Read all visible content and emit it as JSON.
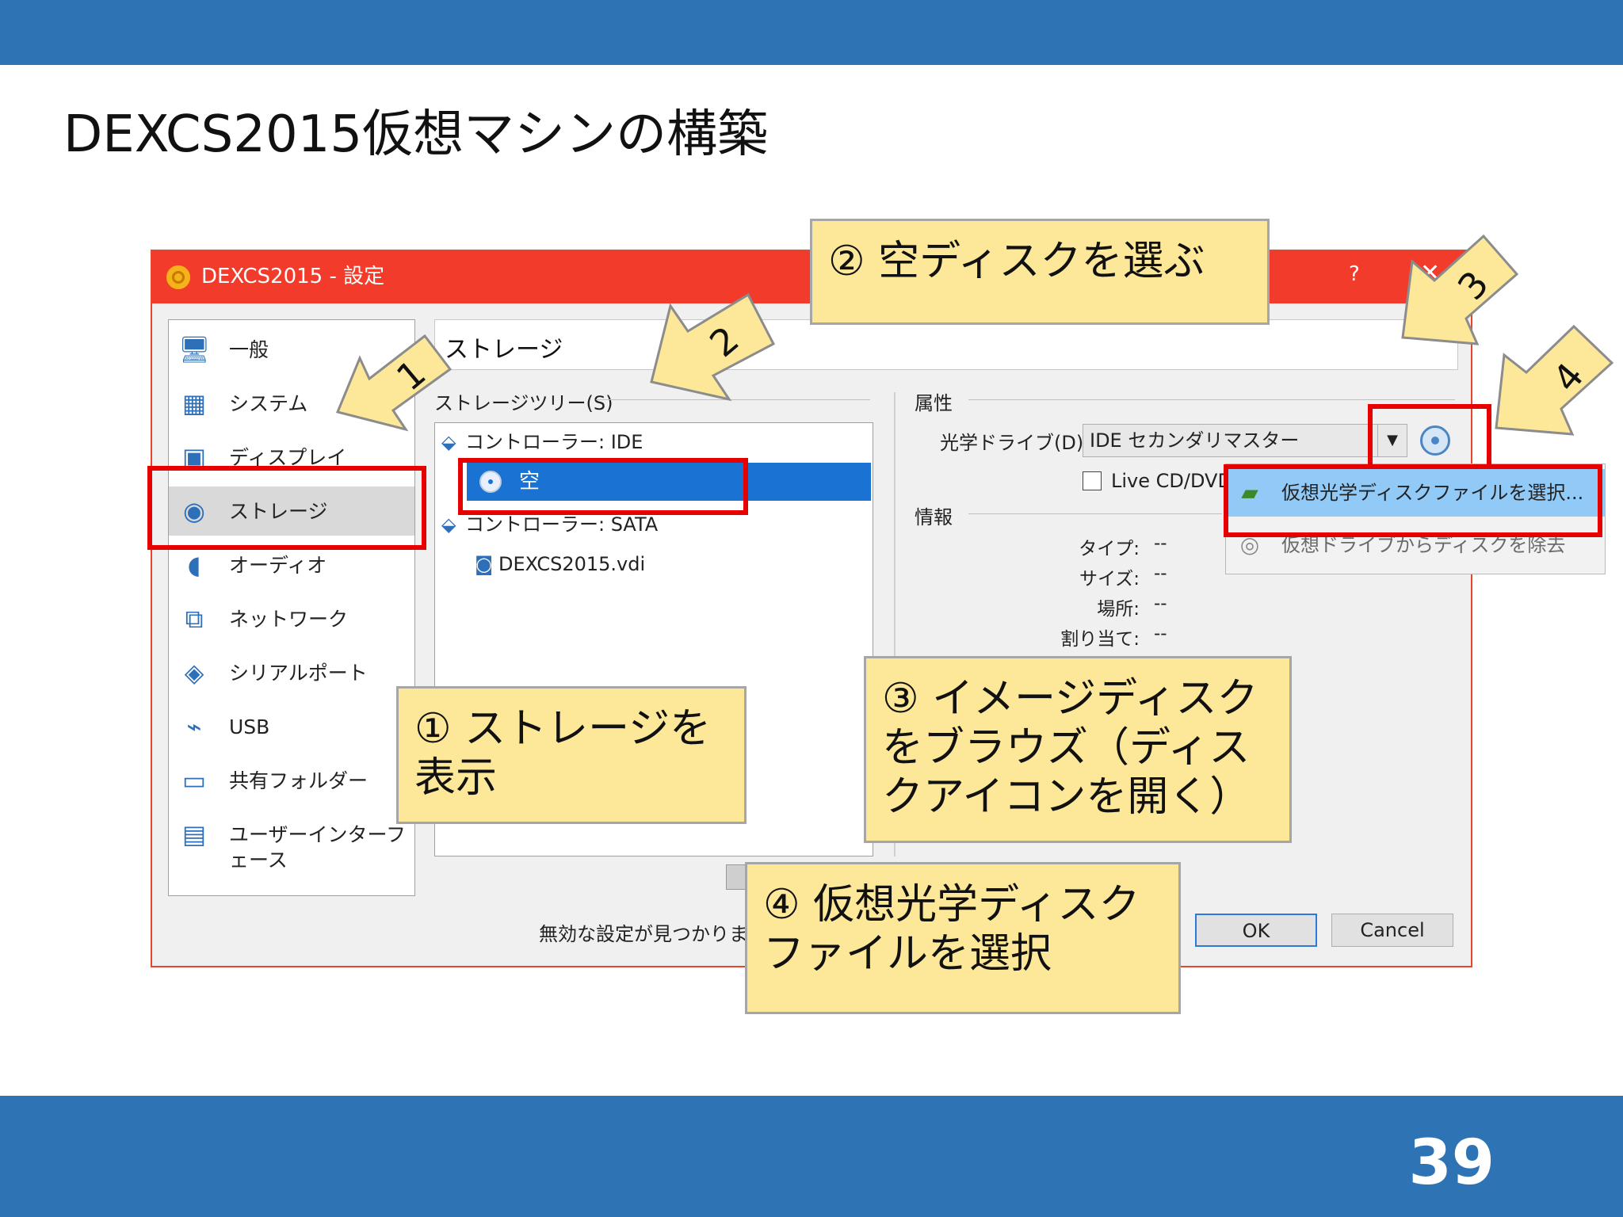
{
  "slide": {
    "title": "DEXCS2015仮想マシンの構築",
    "page_number": "39"
  },
  "dialog": {
    "title": "DEXCS2015 - 設定",
    "help": "?",
    "close": "✕",
    "sidebar": [
      {
        "label": "一般",
        "icon": "computer-icon"
      },
      {
        "label": "システム",
        "icon": "motherboard-icon"
      },
      {
        "label": "ディスプレイ",
        "icon": "monitor-icon"
      },
      {
        "label": "ストレージ",
        "icon": "storage-icon"
      },
      {
        "label": "オーディオ",
        "icon": "speaker-icon"
      },
      {
        "label": "ネットワーク",
        "icon": "network-icon"
      },
      {
        "label": "シリアルポート",
        "icon": "serial-port-icon"
      },
      {
        "label": "USB",
        "icon": "usb-icon"
      },
      {
        "label": "共有フォルダー",
        "icon": "folder-icon"
      },
      {
        "label": "ユーザーインターフェース",
        "icon": "window-icon"
      }
    ],
    "section_title": "ストレージ",
    "tree_group_label": "ストレージツリー(S)",
    "tree": {
      "controller_ide": "コントローラー: IDE",
      "empty_disc": "空",
      "controller_sata": "コントローラー: SATA",
      "vdi": "DEXCS2015.vdi"
    },
    "attributes_label": "属性",
    "optical_drive_label": "光学ドライブ(D):",
    "optical_drive_value": "IDE セカンダリマスター",
    "live_cd_label": "Live CD/DVD",
    "info_label": "情報",
    "info": [
      {
        "label": "タイプ:",
        "value": "--"
      },
      {
        "label": "サイズ:",
        "value": "--"
      },
      {
        "label": "場所:",
        "value": "--"
      },
      {
        "label": "割り当て:",
        "value": "--"
      }
    ],
    "menu": [
      {
        "label": "仮想光学ディスクファイルを選択...",
        "highlighted": true
      },
      {
        "label": "仮想ドライブからディスクを除去",
        "highlighted": false
      }
    ],
    "status_text": "無効な設定が見つかりました",
    "ok_label": "OK",
    "cancel_label": "Cancel"
  },
  "callouts": {
    "c1": "① ストレージを表示",
    "c2": "② 空ディスクを選ぶ",
    "c3": "③ イメージディスクをブラウズ（ディスクアイコンを開く）",
    "c4": "④ 仮想光学ディスクファイルを選択"
  },
  "arrows": [
    "1",
    "2",
    "3",
    "4"
  ],
  "colors": {
    "brand_blue": "#2e74b5",
    "titlebar_red": "#f23b2a",
    "highlight_red": "#e60000",
    "callout_yellow": "#fde899",
    "arrow_yellow": "#fde899",
    "selection_blue": "#1a73d2"
  }
}
